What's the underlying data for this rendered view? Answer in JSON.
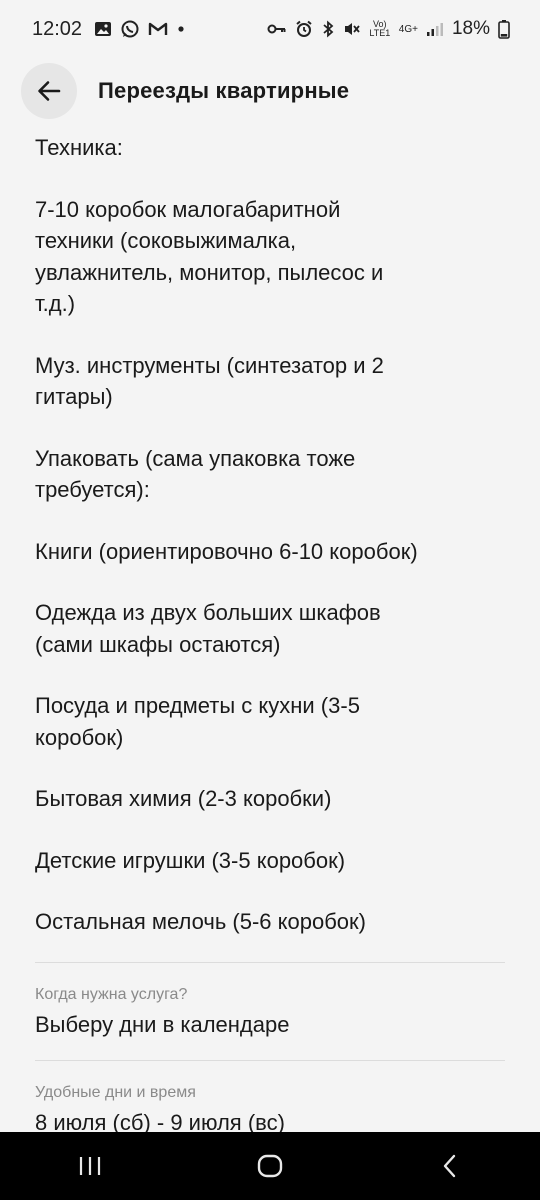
{
  "status_bar": {
    "time": "12:02",
    "battery": "18%",
    "network_label": "4G+",
    "volte_label": "Vo) LTE1",
    "icons": [
      "gallery-icon",
      "whatsapp-icon",
      "gmail-icon",
      "dot-icon",
      "key-icon",
      "alarm-icon",
      "bluetooth-icon",
      "mute-icon",
      "signal-icon"
    ]
  },
  "header": {
    "title": "Переезды квартирные",
    "back_icon": "arrow-left-icon"
  },
  "details": {
    "items": [
      "Техника:",
      "7-10 коробок малогабаритной\nтехники (соковыжималка,\nувлажнитель, монитор, пылесос и\nт.д.)",
      "Муз. инструменты (синтезатор и 2\nгитары)",
      "Упаковать (сама упаковка тоже\nтребуется):",
      "Книги (ориентировочно 6-10 коробок)",
      "Одежда из двух больших шкафов\n(сами шкафы остаются)",
      "Посуда и предметы с кухни (3-5\nкоробок)",
      "Бытовая химия (2-3 коробки)",
      "Детские игрушки (3-5 коробок)",
      "Остальная мелочь (5-6 коробок)"
    ]
  },
  "fields": [
    {
      "label": "Когда нужна услуга?",
      "value": "Выберу дни в календаре"
    },
    {
      "label": "Удобные дни и время",
      "value": "8 июля (сб) - 9 июля (вс)"
    }
  ],
  "nav": {
    "recent_icon": "recent-apps-icon",
    "home_icon": "home-icon",
    "back_icon": "back-icon"
  }
}
